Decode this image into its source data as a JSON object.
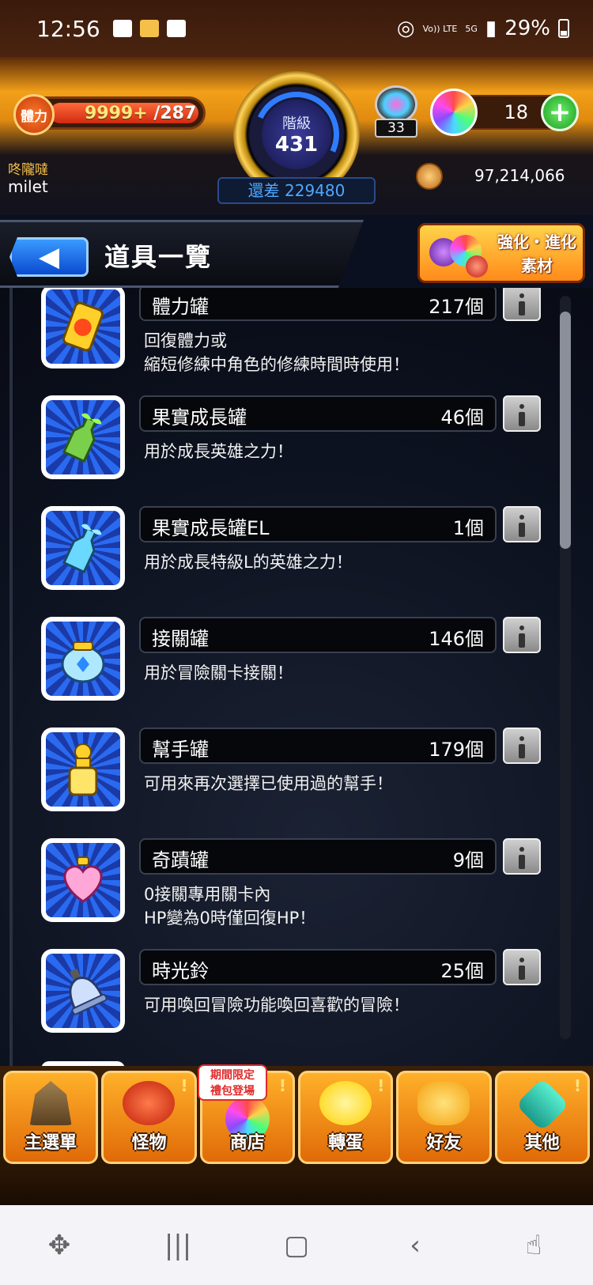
{
  "status_bar": {
    "time": "12:56",
    "volte": "Vo)) LTE",
    "network": "5G",
    "battery": "29%"
  },
  "header": {
    "stamina_label": "體力",
    "stamina_current": "9999+",
    "stamina_max": "/287",
    "rank_label": "階級",
    "rank_value": "431",
    "exp_remaining": "還差 229480",
    "token_count": "33",
    "orb_count": "18",
    "plus_label": "+",
    "username_label": "咚隴噠",
    "username": "milet",
    "coins": "97,214,066"
  },
  "title_bar": {
    "back_icon": "◀",
    "title": "道具一覽",
    "enhance_line1": "強化・進化",
    "enhance_line2": "素材"
  },
  "items": [
    {
      "name": "體力罐",
      "count": "217個",
      "desc1": "回復體力或",
      "desc2": "縮短修練中角色的修練時間時使用！",
      "icon": "stamina-can-icon"
    },
    {
      "name": "果實成長罐",
      "count": "46個",
      "desc1": "用於成長英雄之力！",
      "desc2": "",
      "icon": "fruit-growth-bottle-icon"
    },
    {
      "name": "果實成長罐EL",
      "count": "1個",
      "desc1": "用於成長特級L的英雄之力！",
      "desc2": "",
      "icon": "fruit-growth-el-bottle-icon"
    },
    {
      "name": "接關罐",
      "count": "146個",
      "desc1": "用於冒險關卡接關！",
      "desc2": "",
      "icon": "continue-jar-icon"
    },
    {
      "name": "幫手罐",
      "count": "179個",
      "desc1": "可用來再次選擇已使用過的幫手！",
      "desc2": "",
      "icon": "helper-jar-icon"
    },
    {
      "name": "奇蹟罐",
      "count": "9個",
      "desc1": "0接關專用關卡內",
      "desc2": "HP變為0時僅回復HP！",
      "icon": "miracle-heart-jar-icon"
    },
    {
      "name": "時光鈴",
      "count": "25個",
      "desc1": "可用喚回冒險功能喚回喜歡的冒險！",
      "desc2": "",
      "icon": "time-bell-icon"
    }
  ],
  "bottom_nav": {
    "main_menu": "主選單",
    "monsters": "怪物",
    "shop": "商店",
    "gacha": "轉蛋",
    "friends": "好友",
    "other": "其他",
    "promo_line1": "期間限定",
    "promo_line2": "禮包登場"
  },
  "colors": {
    "header_orange": "#f2a019",
    "nav_orange": "#ffb02a",
    "item_panel_blue": "#2a6af0",
    "exp_text_blue": "#4ea8ff"
  }
}
